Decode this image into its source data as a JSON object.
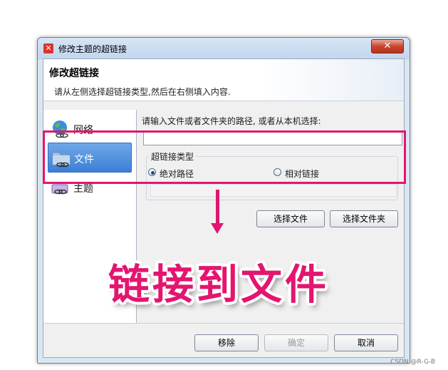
{
  "window": {
    "title": "修改主题的超链接",
    "close_label": "✕"
  },
  "header": {
    "title": "修改超链接",
    "description": "请从左侧选择超链接类型,然后在右侧填入内容."
  },
  "sidebar": {
    "items": [
      {
        "label": "网络",
        "icon": "globe-link-icon",
        "selected": false
      },
      {
        "label": "文件",
        "icon": "folder-link-icon",
        "selected": true
      },
      {
        "label": "主题",
        "icon": "topic-link-icon",
        "selected": false
      }
    ]
  },
  "form": {
    "path_label": "请输入文件或者文件夹的路径, 或者从本机选择:",
    "path_value": "",
    "link_type_title": "超链接类型",
    "options": [
      {
        "label": "绝对路径",
        "checked": true
      },
      {
        "label": "相对链接",
        "checked": false
      }
    ],
    "choose_file_label": "选择文件",
    "choose_folder_label": "选择文件夹"
  },
  "footer": {
    "remove_label": "移除",
    "ok_label": "确定",
    "cancel_label": "取消"
  },
  "annotation": {
    "caption": "链接到文件",
    "color": "#e3156f"
  },
  "watermark": "CSDN @R-G-B"
}
